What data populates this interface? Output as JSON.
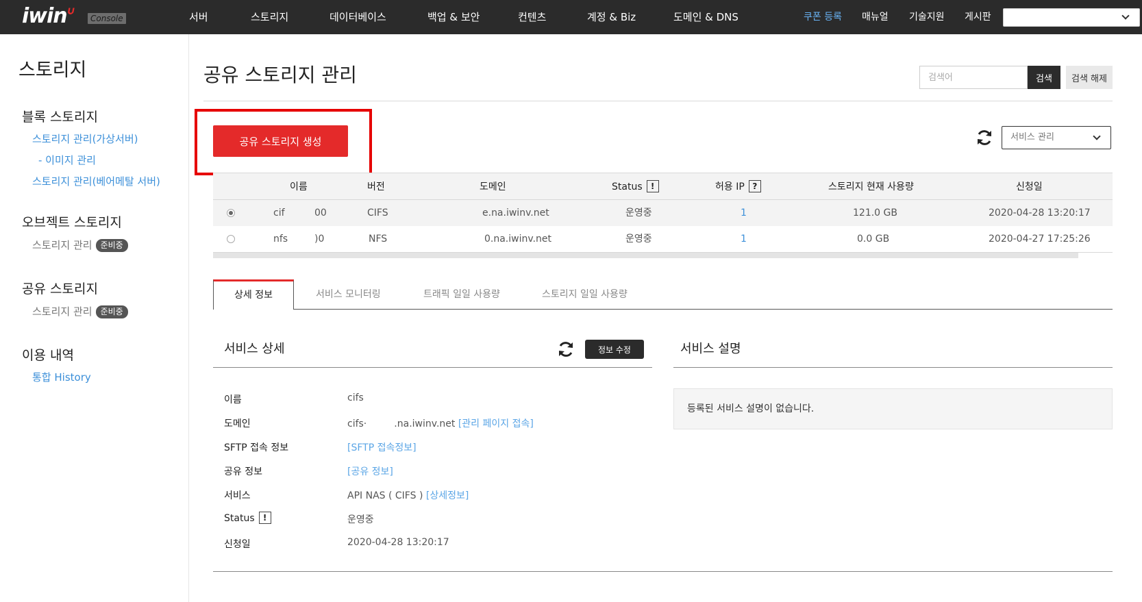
{
  "brand": {
    "logo": "iwinv",
    "badge": "Console"
  },
  "nav": {
    "items": [
      "서버",
      "스토리지",
      "데이터베이스",
      "백업 & 보안",
      "컨텐츠",
      "계정 & Biz",
      "도메인 & DNS"
    ],
    "util": [
      "쿠폰 등록",
      "매뉴얼",
      "기술지원",
      "게시판"
    ],
    "accent_color": "#69b3f5"
  },
  "sidebar": {
    "title": "스토리지",
    "groups": [
      {
        "title": "블록 스토리지",
        "links": [
          "스토리지 관리(가상서버)",
          "- 이미지 관리",
          "스토리지 관리(베어메탈 서버)"
        ]
      },
      {
        "title": "오브젝트 스토리지",
        "links": [
          "스토리지 관리"
        ],
        "badge": "준비중"
      },
      {
        "title": "공유 스토리지",
        "links": [
          "스토리지 관리"
        ],
        "badge": "준비중"
      },
      {
        "title": "이용 내역",
        "links": [
          "통합 History"
        ]
      }
    ]
  },
  "page": {
    "title": "공유 스토리지 관리",
    "search_placeholder": "검색어",
    "search_btn": "검색",
    "clear_btn": "검색 해제",
    "create_btn": "공유 스토리지 생성",
    "service_select": "서비스 관리",
    "create_color": "#e42a2a"
  },
  "table": {
    "headers": [
      "이름",
      "버전",
      "도메인",
      "Status",
      "허용 IP",
      "스토리지 현재 사용량",
      "신청일"
    ],
    "rows": [
      {
        "name": "cif",
        "name_suffix": "00",
        "version": "CIFS",
        "domain": "e.na.iwinv.net",
        "status": "운영중",
        "ip": "1",
        "usage": "121.0 GB",
        "date": "2020-04-28 13:20:17",
        "selected": true
      },
      {
        "name": "nfs",
        "name_suffix": ")0",
        "version": "NFS",
        "domain": "0.na.iwinv.net",
        "status": "운영중",
        "ip": "1",
        "usage": "0.0 GB",
        "date": "2020-04-27 17:25:26",
        "selected": false
      }
    ]
  },
  "tabs": [
    "상세 정보",
    "서비스 모니터링",
    "트래픽 일일 사용량",
    "스토리지 일일 사용량"
  ],
  "detail": {
    "title": "서비스 상세",
    "edit_btn": "정보 수정",
    "fields": [
      {
        "label": "이름",
        "value": "cifs"
      },
      {
        "label": "도메인",
        "value": "cifs·         .na.iwinv.net",
        "link": "[관리 페이지 접속]"
      },
      {
        "label": "SFTP 접속 정보",
        "value": "",
        "link": "[SFTP 접속정보]"
      },
      {
        "label": "공유 정보",
        "value": "",
        "link": "[공유 정보]"
      },
      {
        "label": "서비스",
        "value": "API NAS ( CIFS )",
        "link": "[상세정보]"
      },
      {
        "label": "Status",
        "value": "운영중"
      },
      {
        "label": "신청일",
        "value": "2020-04-28 13:20:17"
      }
    ]
  },
  "description": {
    "title": "서비스 설명",
    "text": "등록된 서비스 설명이 없습니다."
  }
}
